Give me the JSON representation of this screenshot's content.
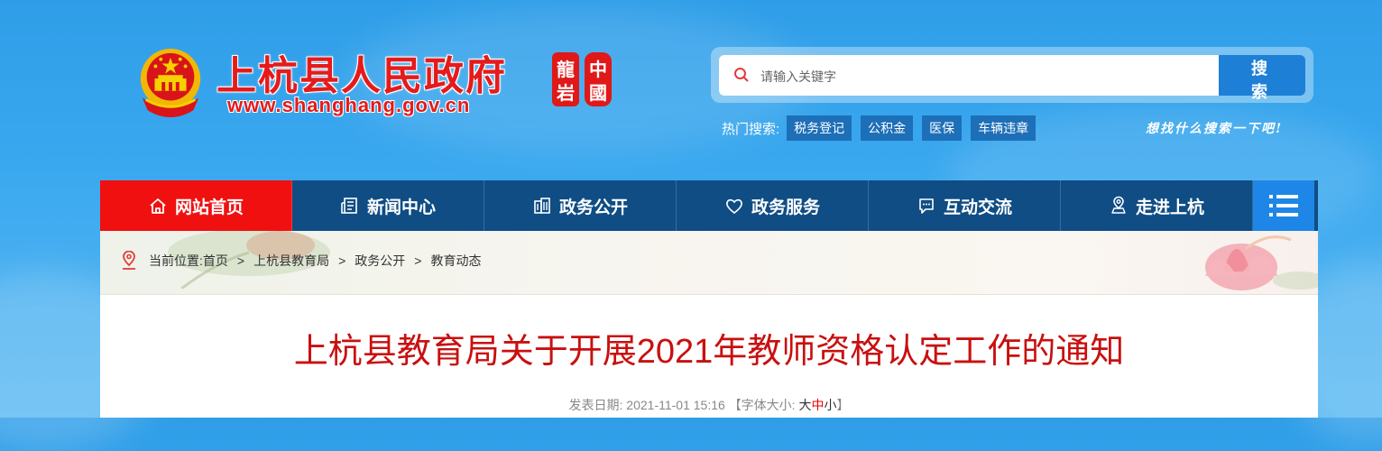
{
  "header": {
    "site_title": "上杭县人民政府",
    "site_url": "www.shanghang.gov.cn",
    "seal_text": [
      "龍",
      "中",
      "岩",
      "國"
    ]
  },
  "search": {
    "placeholder": "请输入关键字",
    "button_label": "搜 索",
    "hot_label": "热门搜索:",
    "hot_tags": [
      "税务登记",
      "公积金",
      "医保",
      "车辆违章"
    ],
    "slogan": "想找什么搜索一下吧!"
  },
  "nav": {
    "items": [
      {
        "label": "网站首页",
        "icon": "home-icon"
      },
      {
        "label": "新闻中心",
        "icon": "news-icon"
      },
      {
        "label": "政务公开",
        "icon": "building-icon"
      },
      {
        "label": "政务服务",
        "icon": "heart-icon"
      },
      {
        "label": "互动交流",
        "icon": "chat-icon"
      },
      {
        "label": "走进上杭",
        "icon": "location-icon"
      }
    ],
    "menu_icon": "menu-icon"
  },
  "breadcrumb": {
    "prefix": "当前位置:",
    "items": [
      "首页",
      "上杭县教育局",
      "政务公开",
      "教育动态"
    ],
    "separator": ">"
  },
  "article": {
    "title": "上杭县教育局关于开展2021年教师资格认定工作的通知",
    "date_label": "发表日期:",
    "date": "2021-11-01 15:16",
    "font_size_label": "【字体大小:",
    "font_sizes": [
      "大",
      "中",
      "小"
    ],
    "font_size_close": "】"
  },
  "colors": {
    "nav_bg": "#0f4d84",
    "nav_active": "#f01010",
    "title_red": "#c8100f",
    "search_btn": "#1e7fd6"
  }
}
